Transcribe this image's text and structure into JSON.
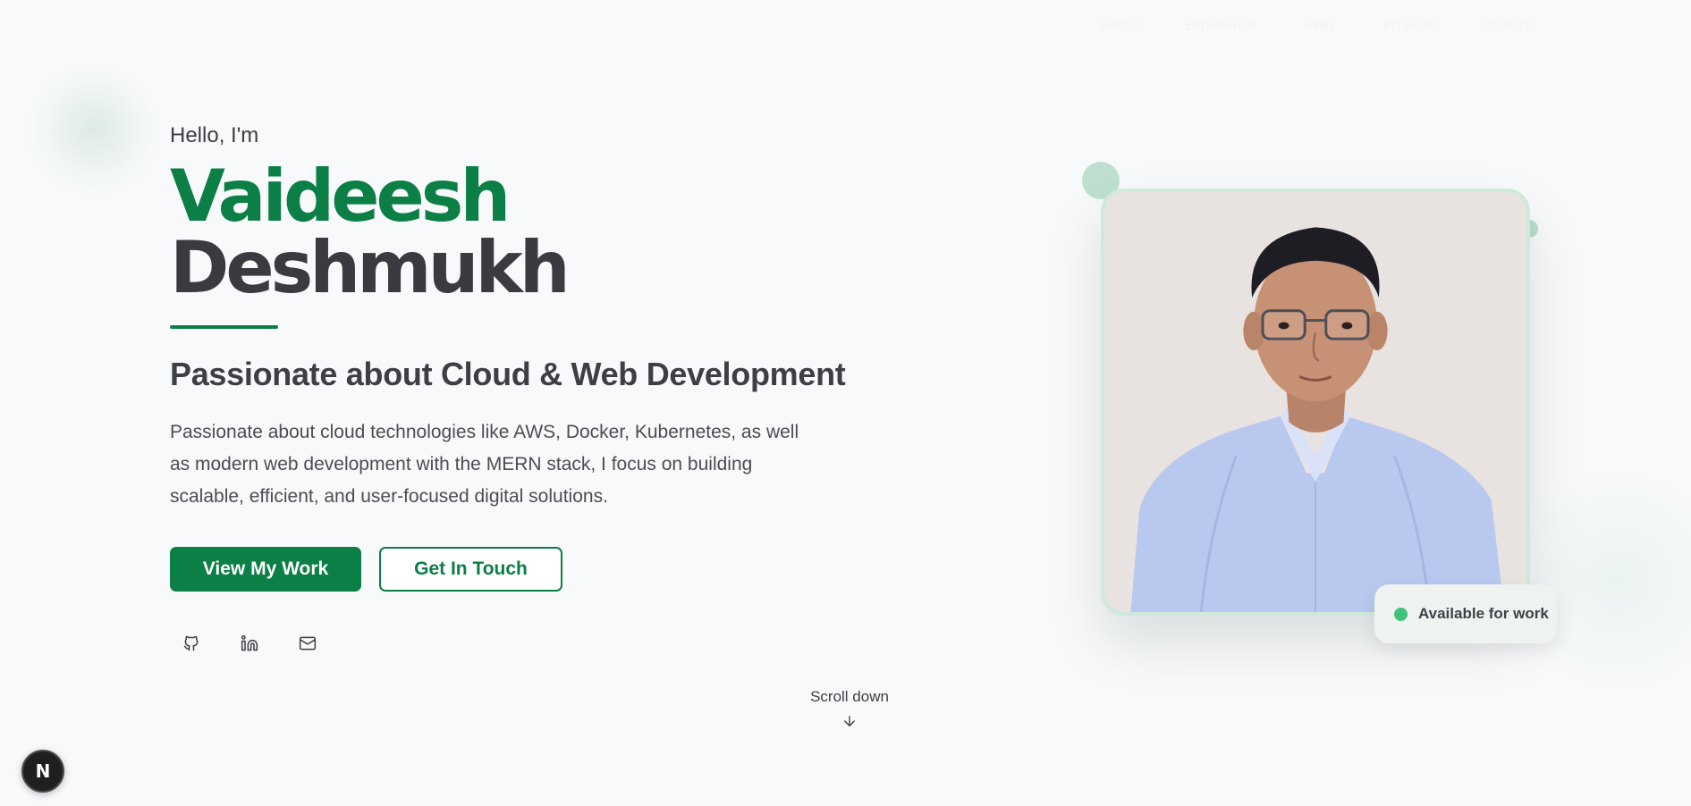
{
  "nav": {
    "items": [
      {
        "label": "About"
      },
      {
        "label": "Experience"
      },
      {
        "label": "Skills"
      },
      {
        "label": "Projects"
      },
      {
        "label": "Contact"
      }
    ]
  },
  "hero": {
    "greeting": "Hello, I'm",
    "first_name": "Vaideesh",
    "last_name": "Deshmukh",
    "tagline": "Passionate about Cloud & Web Development",
    "bio": "Passionate about cloud technologies like AWS, Docker, Kubernetes, as well as modern web development with the MERN stack, I focus on building scalable, efficient, and user-focused digital solutions.",
    "primary_button": "View My Work",
    "secondary_button": "Get In Touch",
    "socials": [
      {
        "icon": "github-icon"
      },
      {
        "icon": "linkedin-icon"
      },
      {
        "icon": "mail-icon"
      }
    ]
  },
  "scroll": {
    "label": "Scroll down",
    "icon": "arrow-down-icon"
  },
  "profile": {
    "status": "Available for work",
    "status_color": "#3ec47a"
  },
  "dev_badge": {
    "letter": "N"
  },
  "colors": {
    "accent": "#0b7f45",
    "background": "#f8f9fb",
    "text": "#3a3d42"
  }
}
